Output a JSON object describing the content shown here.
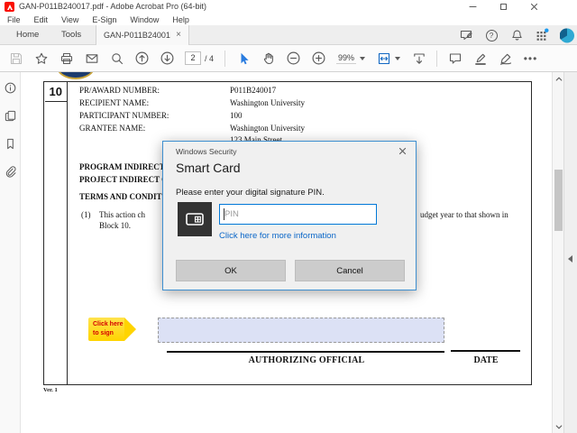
{
  "titlebar": {
    "title": "GAN-P011B240017.pdf - Adobe Acrobat Pro (64-bit)"
  },
  "menubar": {
    "items": [
      "File",
      "Edit",
      "View",
      "E-Sign",
      "Window",
      "Help"
    ]
  },
  "tabbar": {
    "home": "Home",
    "tools": "Tools",
    "document_tab": "GAN-P011B24001...",
    "close_glyph": "×",
    "help_glyph": "?"
  },
  "toolbar": {
    "page_current": "2",
    "page_total": "/ 4",
    "zoom_level": "99%",
    "more_glyph": "•••"
  },
  "dialog": {
    "window_title": "Windows Security",
    "close_glyph": "×",
    "heading": "Smart Card",
    "message": "Please enter your digital signature PIN.",
    "pin_placeholder": "PIN",
    "info_link": "Click here for more information",
    "ok_label": "OK",
    "cancel_label": "Cancel",
    "accent_color": "#0078d7"
  },
  "document": {
    "block_number": "10",
    "rows": [
      {
        "label": "PR/AWARD NUMBER:",
        "value": "P011B240017"
      },
      {
        "label": "RECIPIENT NAME:",
        "value": "Washington University"
      },
      {
        "label": "PARTICIPANT NUMBER:",
        "value": "100"
      },
      {
        "label": "GRANTEE NAME:",
        "value": "Washington University"
      },
      {
        "label": "",
        "value": "123 Main Street"
      }
    ],
    "heading1": "PROGRAM INDIRECT",
    "heading2": "PROJECT INDIRECT C",
    "heading3": "TERMS AND CONDIT",
    "clause_num": "(1)",
    "clause_start": "This action ch",
    "clause_end": "udget year to that shown in",
    "clause_line2": "Block 10.",
    "sign_tag_line1": "Click here",
    "sign_tag_line2": "to sign",
    "authorizing_official": "AUTHORIZING OFFICIAL",
    "date_label": "DATE",
    "version": "Ver. 1",
    "sign_tag_color": "#ffd400",
    "sig_field_color": "#dce1f5"
  }
}
